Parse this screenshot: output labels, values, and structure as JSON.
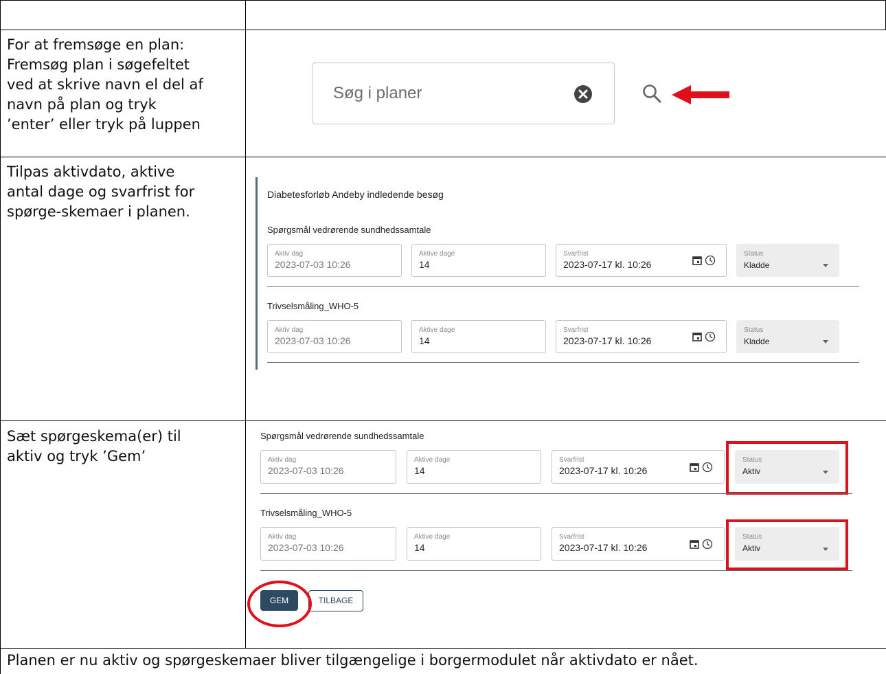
{
  "instructions": {
    "row1": [
      "For at fremsøge en plan:",
      "Fremsøg plan i søgefeltet",
      "ved at skrive navn el del af",
      "navn på plan og tryk",
      "’enter’ eller tryk på luppen"
    ],
    "row2": [
      "Tilpas aktivdato, aktive",
      "antal dage og svarfrist for",
      "spørge-skemaer i planen."
    ],
    "row3": [
      "Sæt spørgeskema(er) til",
      "aktiv og tryk ’Gem’"
    ],
    "footer": "Planen er nu aktiv og spørgeskemaer bliver tilgængelige i borgermodulet når aktivdato er nået."
  },
  "search": {
    "placeholder": "Søg i planer",
    "clear_icon": "clear-circle-icon",
    "search_icon": "magnifier-icon",
    "arrow_icon": "red-arrow-icon"
  },
  "labels": {
    "aktiv_dag": "Aktiv dag",
    "aktive_dage": "Aktive dage",
    "svarfrist": "Svarfrist",
    "status": "Status"
  },
  "plan_editor": {
    "plan_title": "Diabetesforløb Andeby indledende besøg",
    "questionnaires": [
      {
        "title": "Spørgsmål vedrørende sundhedssamtale",
        "aktiv_dag": "2023-07-03 10:26",
        "aktive_dage": "14",
        "svarfrist": "2023-07-17 kl. 10:26",
        "status": "Kladde"
      },
      {
        "title": "Trivselsmåling_WHO-5",
        "aktiv_dag": "2023-07-03 10:26",
        "aktive_dage": "14",
        "svarfrist": "2023-07-17 kl. 10:26",
        "status": "Kladde"
      }
    ]
  },
  "status_editor": {
    "questionnaires": [
      {
        "title": "Spørgsmål vedrørende sundhedssamtale",
        "aktiv_dag": "2023-07-03 10:26",
        "aktive_dage": "14",
        "svarfrist": "2023-07-17 kl. 10:26",
        "status": "Aktiv"
      },
      {
        "title": "Trivselsmåling_WHO-5",
        "aktiv_dag": "2023-07-03 10:26",
        "aktive_dage": "14",
        "svarfrist": "2023-07-17 kl. 10:26",
        "status": "Aktiv"
      }
    ],
    "gem_label": "GEM",
    "tilbage_label": "TILBAGE"
  },
  "colors": {
    "highlight": "#e0101a",
    "primary_button": "#2d4a63"
  }
}
